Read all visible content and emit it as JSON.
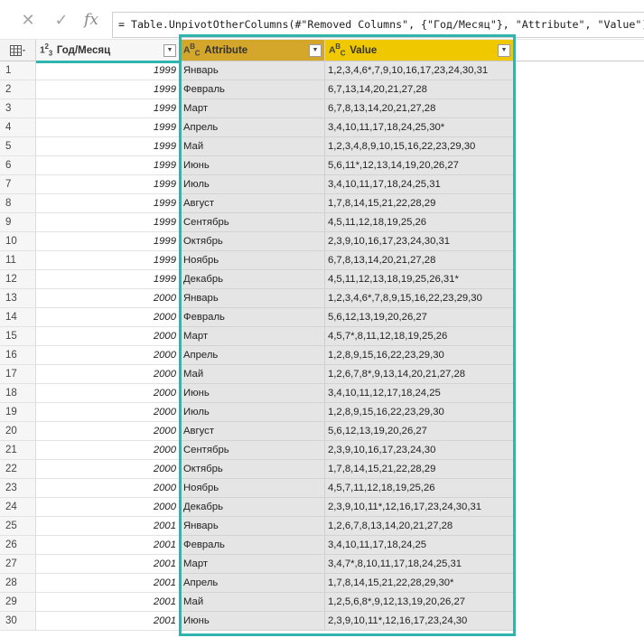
{
  "formula_bar": {
    "formula": "= Table.UnpivotOtherColumns(#\"Removed Columns\", {\"Год/Месяц\"}, \"Attribute\", \"Value\")"
  },
  "columns": {
    "year": {
      "label": "Год/Месяц",
      "type": "123"
    },
    "attribute": {
      "label": "Attribute",
      "type": "ABC"
    },
    "value": {
      "label": "Value",
      "type": "ABC"
    }
  },
  "colors": {
    "attribute_header": "#d4a62a",
    "value_header": "#f0c800",
    "highlight": "#2fb5ad"
  },
  "rows": [
    {
      "n": "1",
      "year": "1999",
      "attr": "Январь",
      "val": "1,2,3,4,6*,7,9,10,16,17,23,24,30,31"
    },
    {
      "n": "2",
      "year": "1999",
      "attr": "Февраль",
      "val": "6,7,13,14,20,21,27,28"
    },
    {
      "n": "3",
      "year": "1999",
      "attr": "Март",
      "val": "6,7,8,13,14,20,21,27,28"
    },
    {
      "n": "4",
      "year": "1999",
      "attr": "Апрель",
      "val": "3,4,10,11,17,18,24,25,30*"
    },
    {
      "n": "5",
      "year": "1999",
      "attr": "Май",
      "val": "1,2,3,4,8,9,10,15,16,22,23,29,30"
    },
    {
      "n": "6",
      "year": "1999",
      "attr": "Июнь",
      "val": "5,6,11*,12,13,14,19,20,26,27"
    },
    {
      "n": "7",
      "year": "1999",
      "attr": "Июль",
      "val": "3,4,10,11,17,18,24,25,31"
    },
    {
      "n": "8",
      "year": "1999",
      "attr": "Август",
      "val": "1,7,8,14,15,21,22,28,29"
    },
    {
      "n": "9",
      "year": "1999",
      "attr": "Сентябрь",
      "val": "4,5,11,12,18,19,25,26"
    },
    {
      "n": "10",
      "year": "1999",
      "attr": "Октябрь",
      "val": "2,3,9,10,16,17,23,24,30,31"
    },
    {
      "n": "11",
      "year": "1999",
      "attr": "Ноябрь",
      "val": "6,7,8,13,14,20,21,27,28"
    },
    {
      "n": "12",
      "year": "1999",
      "attr": "Декабрь",
      "val": "4,5,11,12,13,18,19,25,26,31*"
    },
    {
      "n": "13",
      "year": "2000",
      "attr": "Январь",
      "val": "1,2,3,4,6*,7,8,9,15,16,22,23,29,30"
    },
    {
      "n": "14",
      "year": "2000",
      "attr": "Февраль",
      "val": "5,6,12,13,19,20,26,27"
    },
    {
      "n": "15",
      "year": "2000",
      "attr": "Март",
      "val": "4,5,7*,8,11,12,18,19,25,26"
    },
    {
      "n": "16",
      "year": "2000",
      "attr": "Апрель",
      "val": "1,2,8,9,15,16,22,23,29,30"
    },
    {
      "n": "17",
      "year": "2000",
      "attr": "Май",
      "val": "1,2,6,7,8*,9,13,14,20,21,27,28"
    },
    {
      "n": "18",
      "year": "2000",
      "attr": "Июнь",
      "val": "3,4,10,11,12,17,18,24,25"
    },
    {
      "n": "19",
      "year": "2000",
      "attr": "Июль",
      "val": "1,2,8,9,15,16,22,23,29,30"
    },
    {
      "n": "20",
      "year": "2000",
      "attr": "Август",
      "val": "5,6,12,13,19,20,26,27"
    },
    {
      "n": "21",
      "year": "2000",
      "attr": "Сентябрь",
      "val": "2,3,9,10,16,17,23,24,30"
    },
    {
      "n": "22",
      "year": "2000",
      "attr": "Октябрь",
      "val": "1,7,8,14,15,21,22,28,29"
    },
    {
      "n": "23",
      "year": "2000",
      "attr": "Ноябрь",
      "val": "4,5,7,11,12,18,19,25,26"
    },
    {
      "n": "24",
      "year": "2000",
      "attr": "Декабрь",
      "val": "2,3,9,10,11*,12,16,17,23,24,30,31"
    },
    {
      "n": "25",
      "year": "2001",
      "attr": "Январь",
      "val": "1,2,6,7,8,13,14,20,21,27,28"
    },
    {
      "n": "26",
      "year": "2001",
      "attr": "Февраль",
      "val": "3,4,10,11,17,18,24,25"
    },
    {
      "n": "27",
      "year": "2001",
      "attr": "Март",
      "val": "3,4,7*,8,10,11,17,18,24,25,31"
    },
    {
      "n": "28",
      "year": "2001",
      "attr": "Апрель",
      "val": "1,7,8,14,15,21,22,28,29,30*"
    },
    {
      "n": "29",
      "year": "2001",
      "attr": "Май",
      "val": "1,2,5,6,8*,9,12,13,19,20,26,27"
    },
    {
      "n": "30",
      "year": "2001",
      "attr": "Июнь",
      "val": "2,3,9,10,11*,12,16,17,23,24,30"
    }
  ]
}
